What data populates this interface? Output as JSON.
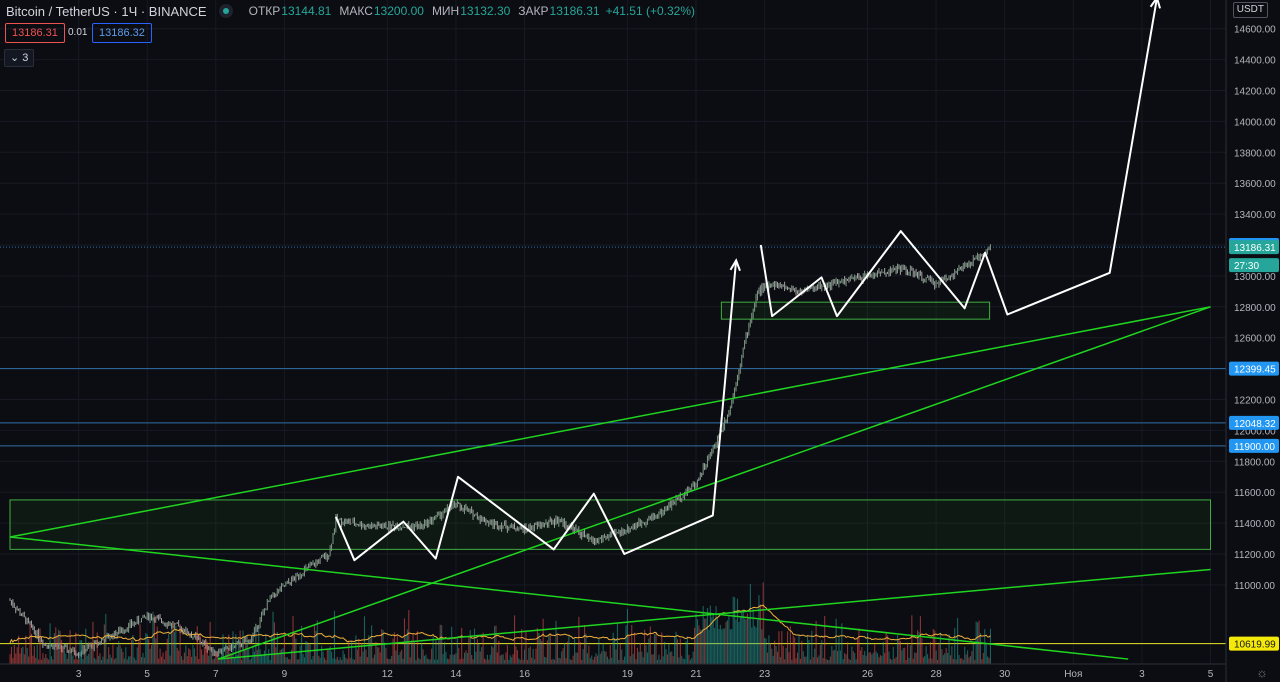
{
  "header": {
    "symbol": "Bitcoin / TetherUS · 1Ч · BINANCE",
    "open_label": "ОТКР",
    "open": "13144.81",
    "high_label": "МАКС",
    "high": "13200.00",
    "low_label": "МИН",
    "low": "13132.30",
    "close_label": "ЗАКР",
    "close": "13186.31",
    "change": "+41.51 (+0.32%)"
  },
  "trade": {
    "sell": "13186.31",
    "spread": "0.01",
    "buy": "13186.32"
  },
  "legend_toggle": "3",
  "axis": {
    "currency": "USDT"
  },
  "colors": {
    "up": "#26a69a",
    "down": "#ef5350",
    "green_line": "#1fd51f",
    "blue_line": "#2f6fa8",
    "yellow_line": "#e8e82a",
    "ma": "#f0b13a",
    "drawing": "#ffffff"
  },
  "chart_data": {
    "type": "candlestick",
    "y_ticks": [
      11000,
      11200,
      11400,
      11600,
      11800,
      12000,
      12200,
      12400,
      12600,
      12800,
      13000,
      13200,
      13400,
      13600,
      13800,
      14000,
      14200,
      14400,
      14600
    ],
    "y_tick_labels": [
      "11000.00",
      "11200.00",
      "11400.00",
      "11600.00",
      "11800.00",
      "12000.00",
      "12200.00",
      "12400.00",
      "12600.00",
      "12800.00",
      "13000.00",
      "13200.00",
      "13400.00",
      "13600.00",
      "13800.00",
      "14000.00",
      "14200.00",
      "14400.00",
      "14600.00"
    ],
    "x_ticks": [
      "3",
      "5",
      "7",
      "9",
      "12",
      "14",
      "16",
      "19",
      "21",
      "23",
      "26",
      "28",
      "30",
      "Ноя",
      "3",
      "5"
    ],
    "price_labels": [
      {
        "value": 13200.0,
        "text": "13200.00",
        "color": "#2196f3"
      },
      {
        "value": 13186.31,
        "text": "13186.31",
        "color": "#26a69a"
      },
      {
        "value": 13070,
        "text": "27:30",
        "color": "#26a69a"
      },
      {
        "value": 12399.45,
        "text": "12399.45",
        "color": "#2196f3"
      },
      {
        "value": 12048.32,
        "text": "12048.32",
        "color": "#2196f3"
      },
      {
        "value": 11900.0,
        "text": "11900.00",
        "color": "#2196f3"
      },
      {
        "value": 10619.99,
        "text": "10619.99",
        "color": "#f5e90a"
      }
    ],
    "horizontal_lines": [
      {
        "value": 13186.31,
        "color": "#2f6fa8"
      },
      {
        "value": 12399.45,
        "color": "#2f6fa8"
      },
      {
        "value": 12048.32,
        "color": "#2f6fa8"
      },
      {
        "value": 11900.0,
        "color": "#2f6fa8"
      },
      {
        "value": 10619.99,
        "color": "#e8e82a"
      }
    ],
    "zones": [
      {
        "day_from": 1,
        "day_to": 36,
        "low": 11230,
        "high": 11550
      },
      {
        "day_from": 21.74,
        "day_to": 29.56,
        "low": 12720,
        "high": 12830
      }
    ],
    "trendlines": [
      {
        "from": [
          1,
          11310
        ],
        "to": [
          36,
          12800
        ]
      },
      {
        "from": [
          7.07,
          10520
        ],
        "to": [
          36,
          11100
        ]
      },
      {
        "from": [
          1,
          11310
        ],
        "to": [
          33.6,
          10520
        ]
      },
      {
        "from": [
          7.07,
          10520
        ],
        "to": [
          36,
          12800
        ]
      }
    ],
    "path_points": [
      [
        10.5,
        11440
      ],
      [
        11.04,
        11160
      ],
      [
        12.47,
        11410
      ],
      [
        13.41,
        11170
      ],
      [
        14.06,
        11700
      ],
      [
        16.85,
        11230
      ],
      [
        18.02,
        11590
      ],
      [
        18.91,
        11200
      ],
      [
        21.49,
        11450
      ],
      [
        22.17,
        13100
      ]
    ],
    "path2_points": [
      [
        22.89,
        13200
      ],
      [
        23.22,
        12740
      ],
      [
        24.66,
        12990
      ],
      [
        25.11,
        12740
      ],
      [
        26.97,
        13290
      ],
      [
        28.83,
        12790
      ],
      [
        29.43,
        13150
      ],
      [
        30.08,
        12750
      ],
      [
        33.06,
        13020
      ],
      [
        34.44,
        14800
      ]
    ]
  }
}
